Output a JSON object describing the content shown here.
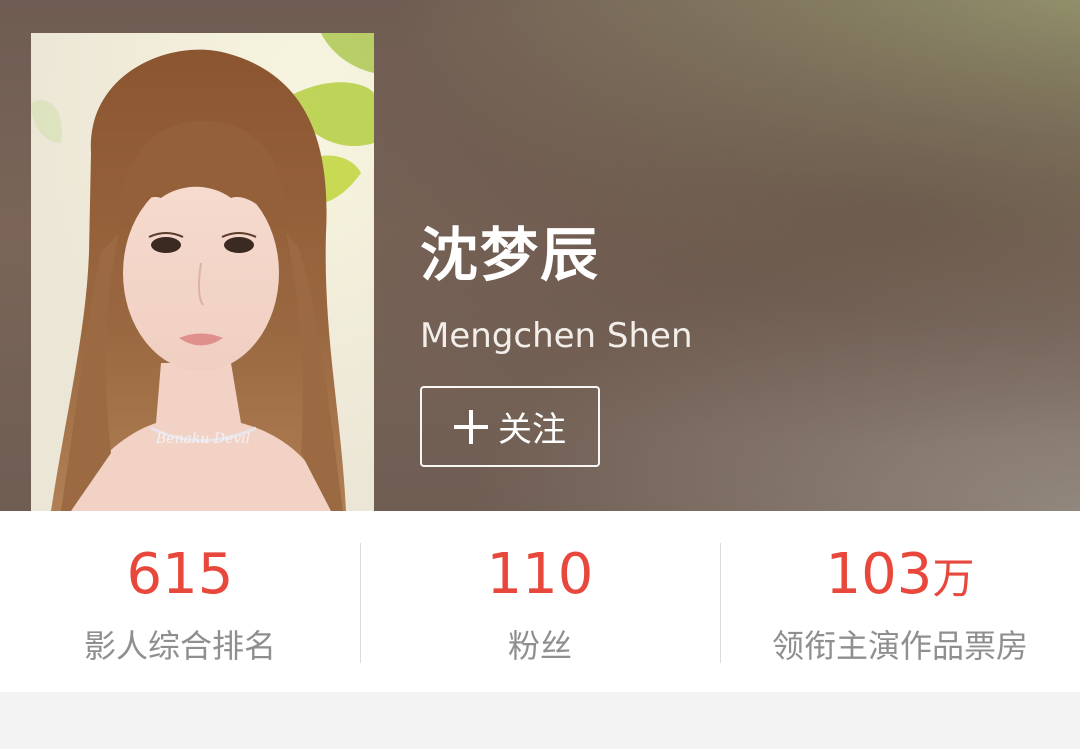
{
  "actor": {
    "name_cn": "沈梦辰",
    "name_en": "Mengchen Shen",
    "follow_label": "关注",
    "poster_icon": "portrait-photo",
    "follow_icon": "plus-icon"
  },
  "stats": [
    {
      "value": "615",
      "unit": "",
      "label": "影人综合排名"
    },
    {
      "value": "110",
      "unit": "",
      "label": "粉丝"
    },
    {
      "value": "103",
      "unit": "万",
      "label": "领衔主演作品票房"
    }
  ],
  "colors": {
    "accent": "#e8483c",
    "label": "#8f8f8f",
    "hero_bg": "#7a6558"
  }
}
